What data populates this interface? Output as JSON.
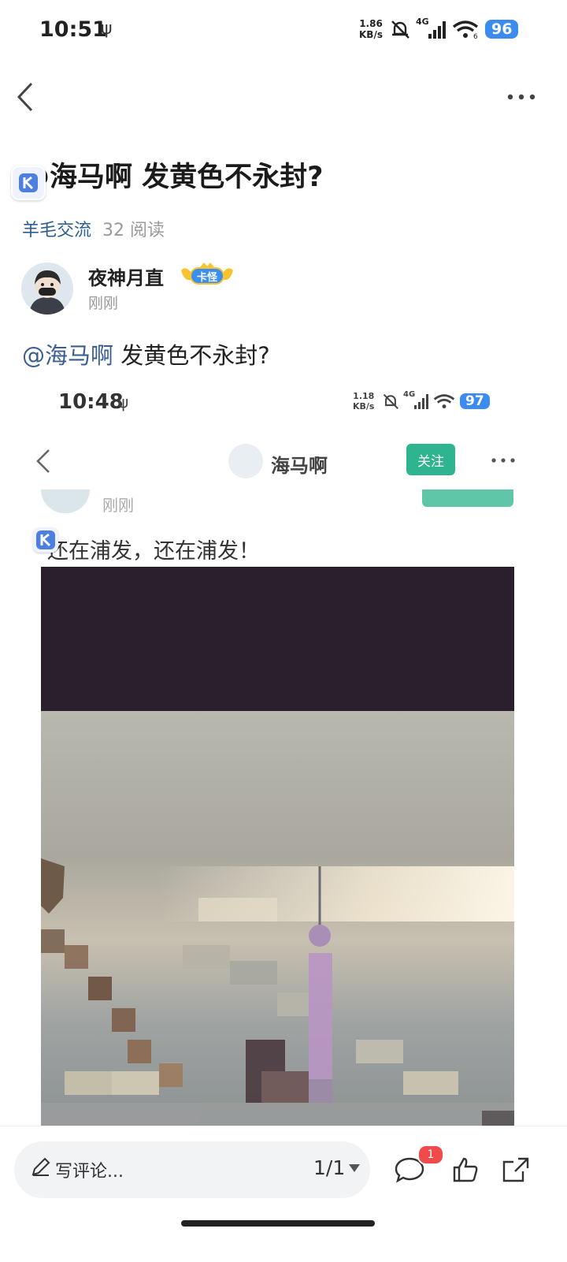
{
  "status_bar": {
    "time": "10:51",
    "usb_symbol": "ψ",
    "speed_value": "1.86",
    "speed_unit": "KB/s",
    "network": "4G",
    "wifi_sub": "6",
    "battery": "96"
  },
  "nav": {
    "back_icon": "chevron-left-icon",
    "more_icon": "more-horizontal-icon"
  },
  "post": {
    "title": "@海马啊 发黄色不永封?",
    "category": "羊毛交流",
    "reads": "32 阅读",
    "author": "夜神月直",
    "author_badge": "卡怪",
    "time": "刚刚",
    "mention": "@海马啊",
    "text": " 发黄色不永封?"
  },
  "embedded": {
    "status": {
      "time": "10:48",
      "usb_symbol": "ψ",
      "speed_value": "1.18",
      "speed_unit": "KB/s",
      "network": "4G",
      "battery": "97"
    },
    "header_name": "海马啊",
    "follow_label": "关注",
    "ghost_time": "刚刚",
    "body": "还在浦发，还在浦发！"
  },
  "bottom_bar": {
    "comment_placeholder": "写评论...",
    "pager": "1/1",
    "comment_count": "1"
  },
  "colors": {
    "accent_blue": "#3a5f8f",
    "follow_green": "#2fb490",
    "badge_red": "#f04b4b",
    "battery_blue": "#3c8cf0"
  }
}
